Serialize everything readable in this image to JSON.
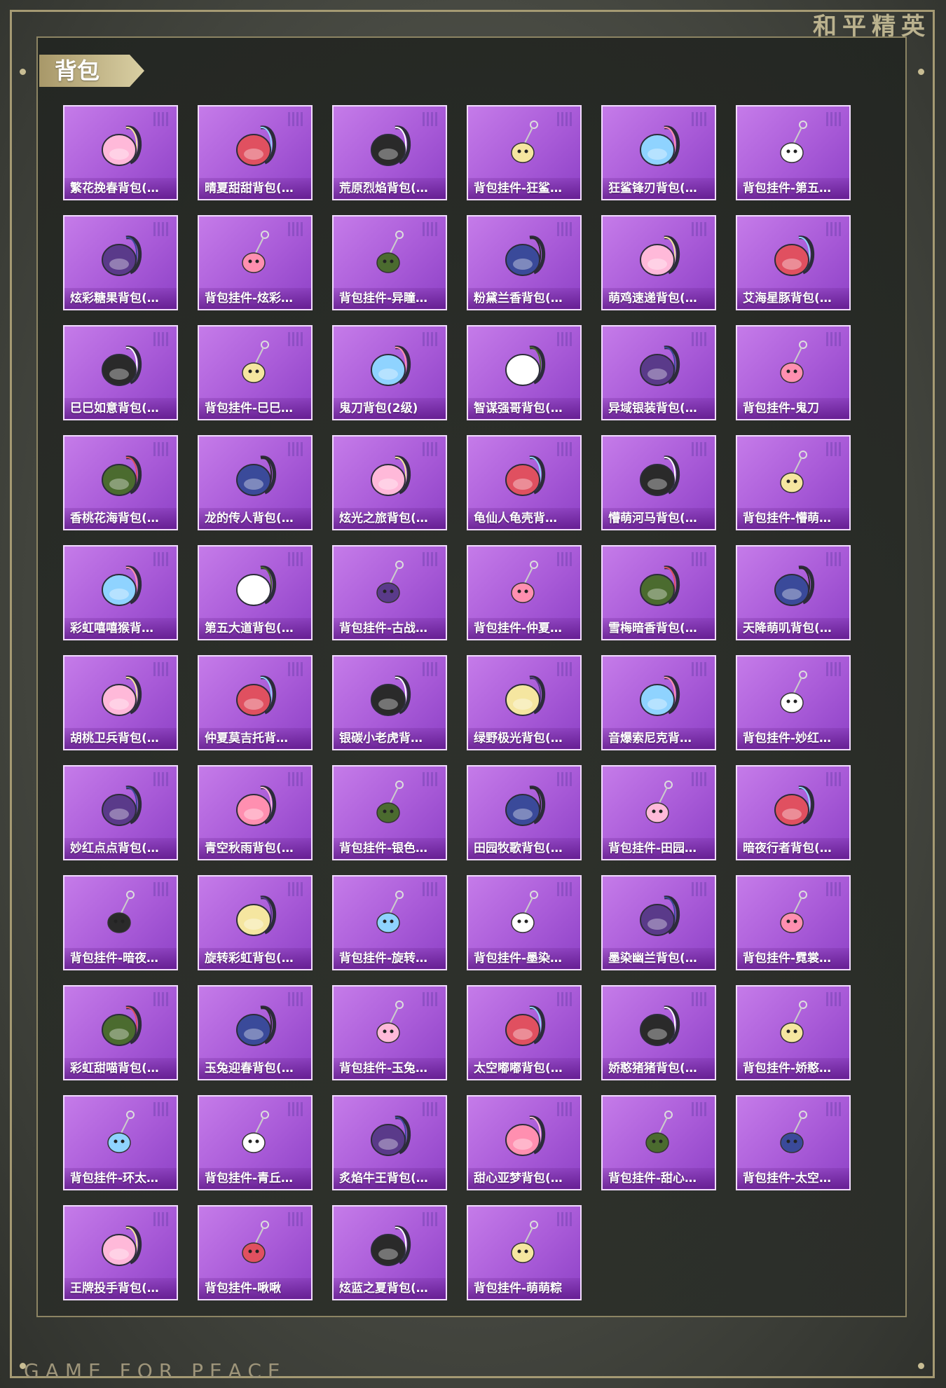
{
  "brand": {
    "top_title": "和平精英",
    "bottom_text": "GAME FOR PEACE"
  },
  "section": {
    "title": "背包"
  },
  "colors": {
    "card_purple": "#a95bd8",
    "frame_gold": "#a59a73"
  },
  "items": [
    {
      "label": "繁花挽春背包(…",
      "icon": "backpack-icon"
    },
    {
      "label": "晴夏甜甜背包(…",
      "icon": "backpack-icon"
    },
    {
      "label": "荒原烈焰背包(…",
      "icon": "backpack-icon"
    },
    {
      "label": "背包挂件-狂鲨…",
      "icon": "charm-icon"
    },
    {
      "label": "狂鲨锋刃背包(…",
      "icon": "backpack-icon"
    },
    {
      "label": "背包挂件-第五…",
      "icon": "charm-icon"
    },
    {
      "label": "炫彩糖果背包(…",
      "icon": "backpack-icon"
    },
    {
      "label": "背包挂件-炫彩…",
      "icon": "charm-icon"
    },
    {
      "label": "背包挂件-异瞳…",
      "icon": "charm-icon"
    },
    {
      "label": "粉黛兰香背包(…",
      "icon": "backpack-icon"
    },
    {
      "label": "萌鸡速递背包(…",
      "icon": "backpack-icon"
    },
    {
      "label": "艾海星豚背包(…",
      "icon": "backpack-icon"
    },
    {
      "label": "巳巳如意背包(…",
      "icon": "backpack-icon"
    },
    {
      "label": "背包挂件-巳巳…",
      "icon": "charm-icon"
    },
    {
      "label": "鬼刀背包(2级)",
      "icon": "backpack-icon"
    },
    {
      "label": "智谋强哥背包(…",
      "icon": "backpack-icon"
    },
    {
      "label": "异域银装背包(…",
      "icon": "backpack-icon"
    },
    {
      "label": "背包挂件-鬼刀",
      "icon": "charm-icon"
    },
    {
      "label": "香桃花海背包(…",
      "icon": "backpack-icon"
    },
    {
      "label": "龙的传人背包(…",
      "icon": "backpack-icon"
    },
    {
      "label": "炫光之旅背包(…",
      "icon": "backpack-icon"
    },
    {
      "label": "龟仙人龟壳背…",
      "icon": "backpack-icon"
    },
    {
      "label": "懵萌河马背包(…",
      "icon": "backpack-icon"
    },
    {
      "label": "背包挂件-懵萌…",
      "icon": "charm-icon"
    },
    {
      "label": "彩虹嘻嘻猴背…",
      "icon": "backpack-icon"
    },
    {
      "label": "第五大道背包(…",
      "icon": "backpack-icon"
    },
    {
      "label": "背包挂件-古战…",
      "icon": "charm-icon"
    },
    {
      "label": "背包挂件-仲夏…",
      "icon": "charm-icon"
    },
    {
      "label": "雪梅暗香背包(…",
      "icon": "backpack-icon"
    },
    {
      "label": "天降萌叽背包(…",
      "icon": "backpack-icon"
    },
    {
      "label": "胡桃卫兵背包(…",
      "icon": "backpack-icon"
    },
    {
      "label": "仲夏莫吉托背…",
      "icon": "backpack-icon"
    },
    {
      "label": "银碳小老虎背…",
      "icon": "backpack-icon"
    },
    {
      "label": "绿野极光背包(…",
      "icon": "backpack-icon"
    },
    {
      "label": "音爆索尼克背…",
      "icon": "backpack-icon"
    },
    {
      "label": "背包挂件-妙红…",
      "icon": "charm-icon"
    },
    {
      "label": "妙红点点背包(…",
      "icon": "backpack-icon"
    },
    {
      "label": "青空秋雨背包(…",
      "icon": "backpack-icon"
    },
    {
      "label": "背包挂件-银色…",
      "icon": "charm-icon"
    },
    {
      "label": "田园牧歌背包(…",
      "icon": "backpack-icon"
    },
    {
      "label": "背包挂件-田园…",
      "icon": "charm-icon"
    },
    {
      "label": "暗夜行者背包(…",
      "icon": "backpack-icon"
    },
    {
      "label": "背包挂件-暗夜…",
      "icon": "charm-icon"
    },
    {
      "label": "旋转彩虹背包(…",
      "icon": "backpack-icon"
    },
    {
      "label": "背包挂件-旋转…",
      "icon": "charm-icon"
    },
    {
      "label": "背包挂件-墨染…",
      "icon": "charm-icon"
    },
    {
      "label": "墨染幽兰背包(…",
      "icon": "backpack-icon"
    },
    {
      "label": "背包挂件-霓裳…",
      "icon": "charm-icon"
    },
    {
      "label": "彩虹甜喵背包(…",
      "icon": "backpack-icon"
    },
    {
      "label": "玉兔迎春背包(…",
      "icon": "backpack-icon"
    },
    {
      "label": "背包挂件-玉兔…",
      "icon": "charm-icon"
    },
    {
      "label": "太空嘟嘟背包(…",
      "icon": "backpack-icon"
    },
    {
      "label": "娇憨猪猪背包(…",
      "icon": "backpack-icon"
    },
    {
      "label": "背包挂件-娇憨…",
      "icon": "charm-icon"
    },
    {
      "label": "背包挂件-环太…",
      "icon": "charm-icon"
    },
    {
      "label": "背包挂件-青丘…",
      "icon": "charm-icon"
    },
    {
      "label": "炙焰牛王背包(…",
      "icon": "backpack-icon"
    },
    {
      "label": "甜心亚梦背包(…",
      "icon": "backpack-icon"
    },
    {
      "label": "背包挂件-甜心…",
      "icon": "charm-icon"
    },
    {
      "label": "背包挂件-太空…",
      "icon": "charm-icon"
    },
    {
      "label": "王牌投手背包(…",
      "icon": "backpack-icon"
    },
    {
      "label": "背包挂件-啾啾",
      "icon": "charm-icon"
    },
    {
      "label": "炫蓝之夏背包(…",
      "icon": "backpack-icon"
    },
    {
      "label": "背包挂件-萌萌粽",
      "icon": "charm-icon"
    }
  ]
}
